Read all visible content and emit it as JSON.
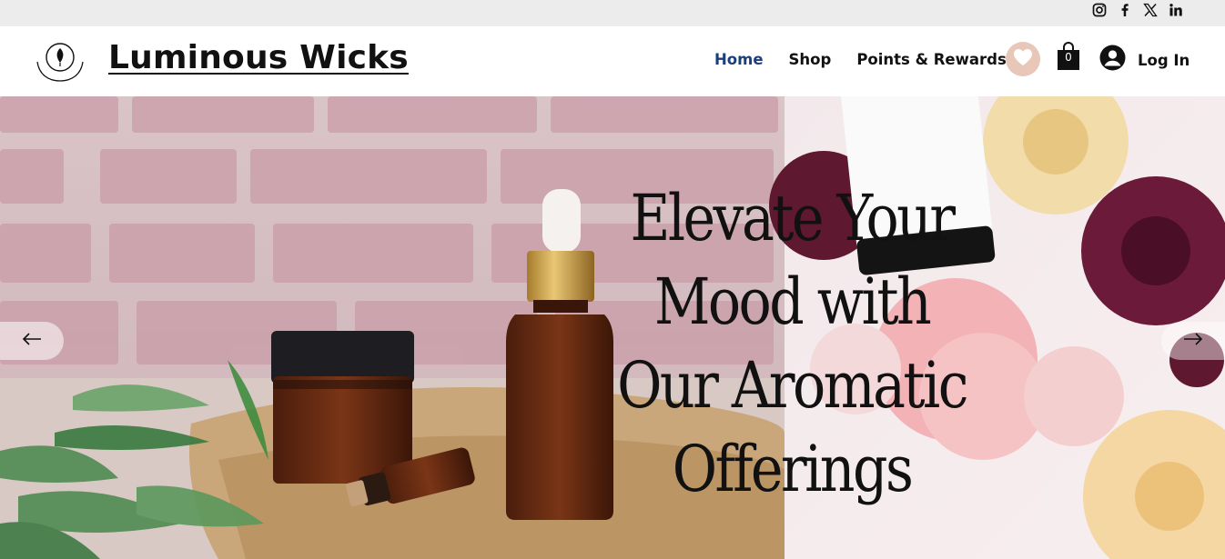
{
  "social": {
    "icons": [
      "instagram-icon",
      "facebook-icon",
      "x-icon",
      "linkedin-icon"
    ]
  },
  "header": {
    "brand": "Luminous Wicks",
    "nav": {
      "home": "Home",
      "shop": "Shop",
      "rewards": "Points & Rewards"
    },
    "cart_count": "0",
    "login": "Log In"
  },
  "hero": {
    "headline_lines": [
      "Elevate Your",
      "Mood with",
      "Our Aromatic",
      "Offerings"
    ]
  },
  "colors": {
    "active_nav": "#1c3e7a",
    "heart_bg": "#e8c6b8",
    "topbar_bg": "#ececec"
  }
}
